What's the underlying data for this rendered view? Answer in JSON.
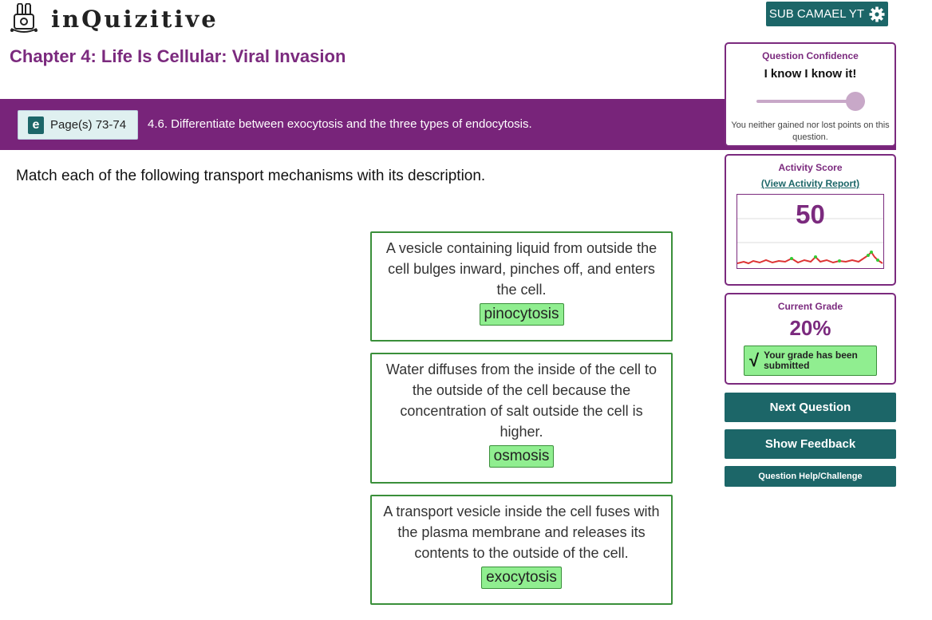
{
  "header": {
    "logo_text": "inQuizitive",
    "user_button": "SUB CAMAEL YT"
  },
  "chapter": {
    "title": "Chapter 4: Life Is Cellular: Viral Invasion"
  },
  "objective_bar": {
    "page_label": "Page(s) 73-74",
    "objective_text": "4.6. Differentiate between exocytosis and the three types of endocytosis."
  },
  "question": {
    "prompt": "Match each of the following transport mechanisms with its description."
  },
  "matches": [
    {
      "description": "A vesicle containing liquid from outside the cell bulges inward, pinches off, and enters the cell.",
      "answer": "pinocytosis"
    },
    {
      "description": "Water diffuses from the inside of the cell to the outside of the cell because the concentration of salt outside the cell is higher.",
      "answer": "osmosis"
    },
    {
      "description": "A transport vesicle inside the cell fuses with the plasma membrane and releases its contents to the outside of the cell.",
      "answer": "exocytosis"
    }
  ],
  "confidence": {
    "title": "Question Confidence",
    "value": "I know I know it!",
    "slider_level": 1.0,
    "note": "You neither gained nor lost points on this question."
  },
  "activity": {
    "title": "Activity Score",
    "report_link": "(View Activity Report)",
    "score": "50"
  },
  "grade": {
    "title": "Current Grade",
    "value": "20%",
    "submitted_text": "Your grade has been submitted"
  },
  "actions": {
    "next": "Next Question",
    "feedback": "Show Feedback",
    "help": "Question Help/Challenge"
  },
  "colors": {
    "purple": "#78247a",
    "teal": "#1c6668",
    "correct_green": "#90ee90"
  }
}
